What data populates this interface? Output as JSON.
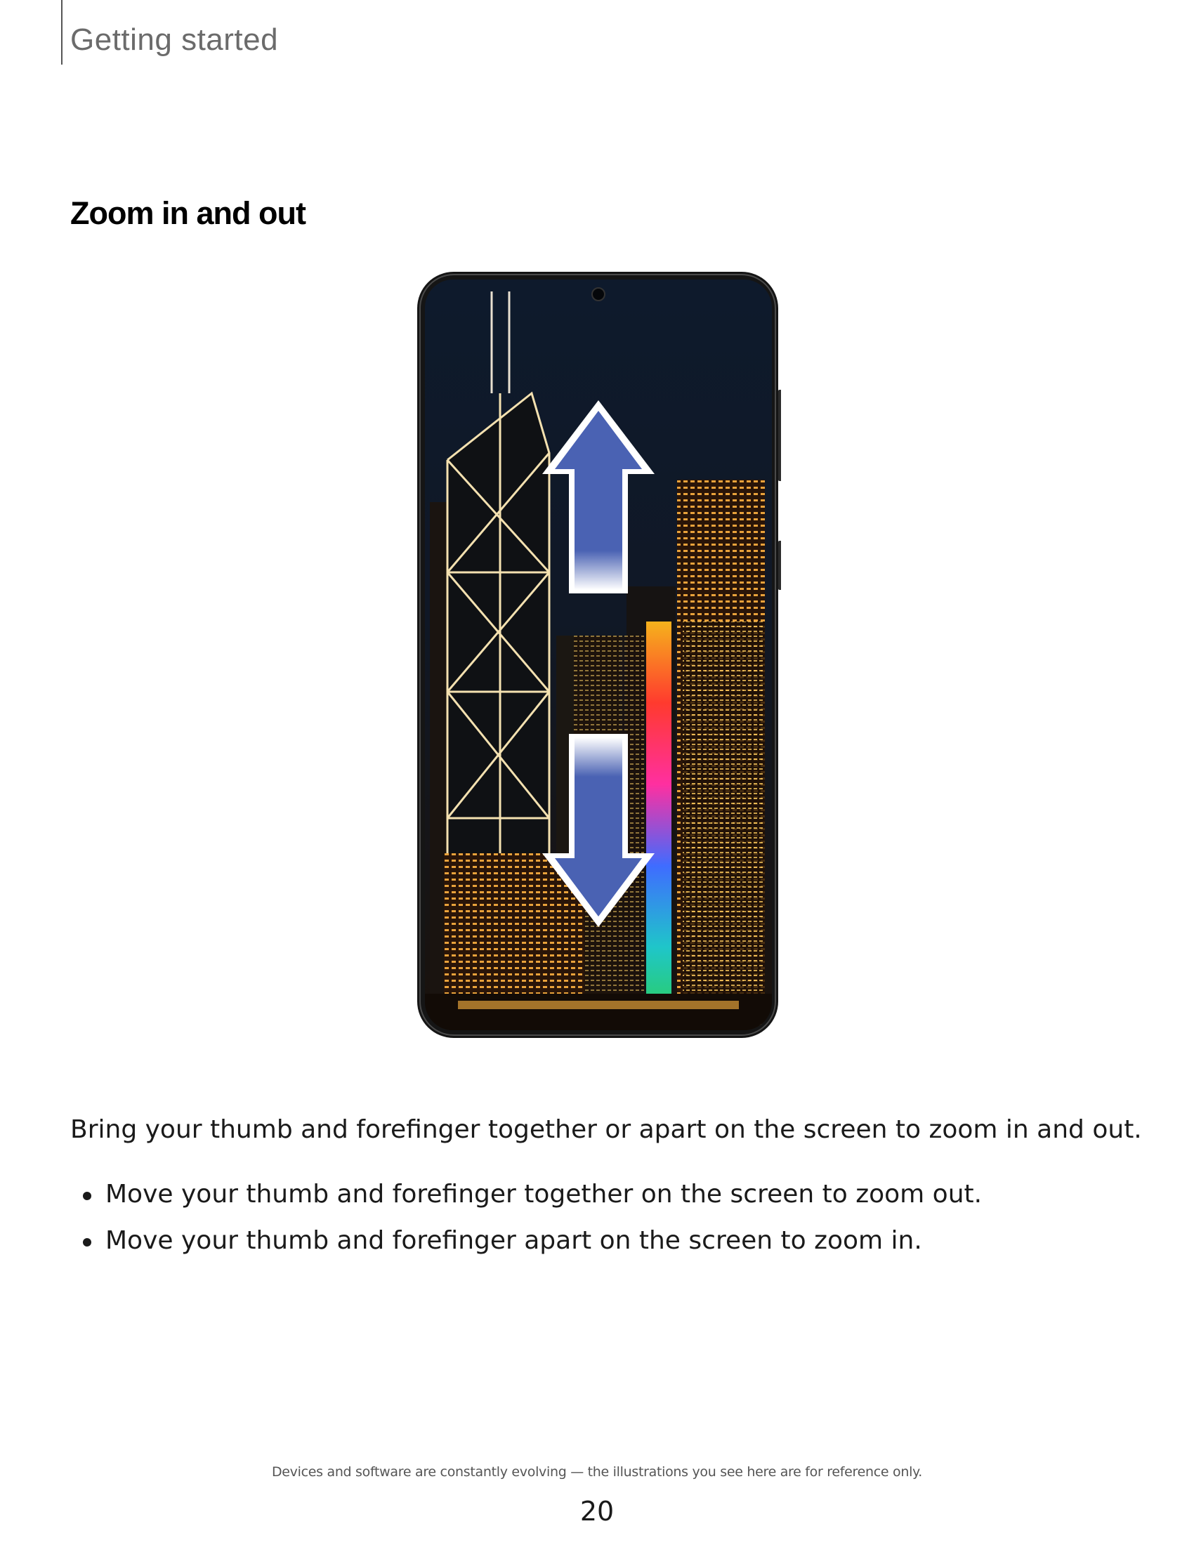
{
  "header": {
    "section": "Getting started"
  },
  "heading": "Zoom in and out",
  "figure": {
    "icon": "phone-pinch-zoom-illustration",
    "arrow_color": "#4a62b3",
    "arrow_outline": "#ffffff"
  },
  "body": {
    "intro": "Bring your thumb and forefinger together or apart on the screen to zoom in and out.",
    "bullets": [
      "Move your thumb and forefinger together on the screen to zoom out.",
      "Move your thumb and forefinger apart on the screen to zoom in."
    ]
  },
  "footer": {
    "note": "Devices and software are constantly evolving — the illustrations you see here are for reference only.",
    "page_number": "20"
  }
}
